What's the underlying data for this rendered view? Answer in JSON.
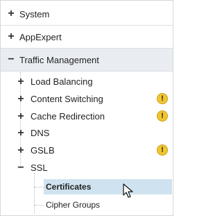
{
  "tree": {
    "system": {
      "label": "System",
      "icon": "plus-icon"
    },
    "appexpert": {
      "label": "AppExpert",
      "icon": "plus-icon"
    },
    "traffic_management": {
      "label": "Traffic Management",
      "icon": "minus-icon",
      "children": {
        "load_balancing": {
          "label": "Load Balancing",
          "icon": "plus-icon"
        },
        "content_switching": {
          "label": "Content Switching",
          "icon": "plus-icon",
          "badge": "!"
        },
        "cache_redirection": {
          "label": "Cache Redirection",
          "icon": "plus-icon",
          "badge": "!"
        },
        "dns": {
          "label": "DNS",
          "icon": "plus-icon"
        },
        "gslb": {
          "label": "GSLB",
          "icon": "plus-icon",
          "badge": "!"
        },
        "ssl": {
          "label": "SSL",
          "icon": "minus-icon",
          "children": {
            "certificates": {
              "label": "Certificates",
              "selected": true
            },
            "cipher_groups": {
              "label": "Cipher Groups"
            }
          }
        }
      }
    }
  },
  "colors": {
    "selection": "#cfe2ef",
    "warning": "#f2c530",
    "border": "#dcdfe3"
  }
}
